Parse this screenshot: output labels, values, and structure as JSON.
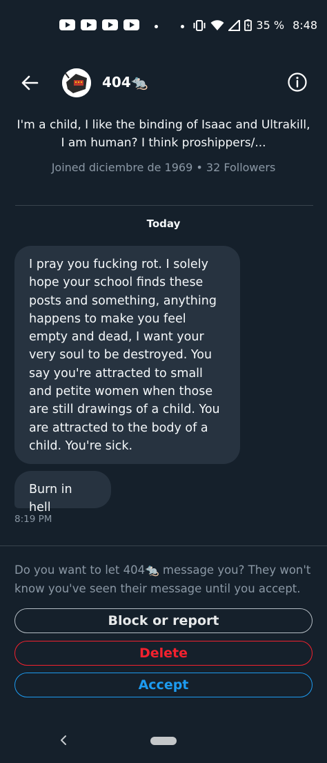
{
  "status_bar": {
    "notification_icons": [
      "youtube-icon",
      "youtube-icon",
      "youtube-icon",
      "youtube-icon"
    ],
    "battery": "35 %",
    "time": "8:48"
  },
  "header": {
    "name": "404🐀"
  },
  "profile": {
    "bio": "I'm a child, I like the binding of Isaac and Ultrakill, I am human? I think  proshippers/...",
    "joined": "Joined diciembre de 1969 • 32 Followers"
  },
  "conversation": {
    "date_label": "Today",
    "messages": [
      {
        "text": "I pray you fucking rot. I solely hope your school finds these posts and something, anything happens to make you feel empty and dead, I want your very soul to be destroyed. You say you're attracted to small and petite women when those are still drawings of a child. You are attracted to the body of a child. You're sick."
      },
      {
        "text": "Burn in hell"
      }
    ],
    "timestamp": "8:19 PM"
  },
  "request": {
    "prompt": "Do you want to let 404🐀 message you? They won't know you've seen their message until you accept.",
    "block_label": "Block or report",
    "delete_label": "Delete",
    "accept_label": "Accept"
  },
  "colors": {
    "background": "#15202b",
    "bubble": "#273340",
    "secondary_text": "#8b98a5",
    "delete": "#f4212e",
    "accept": "#1d9bf0"
  }
}
